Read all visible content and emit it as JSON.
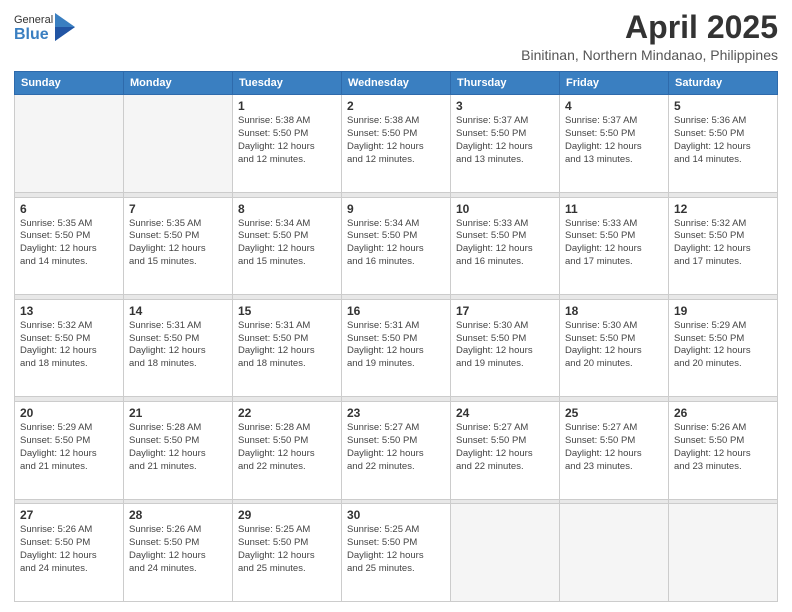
{
  "logo": {
    "general": "General",
    "blue": "Blue"
  },
  "header": {
    "month": "April 2025",
    "location": "Binitinan, Northern Mindanao, Philippines"
  },
  "weekdays": [
    "Sunday",
    "Monday",
    "Tuesday",
    "Wednesday",
    "Thursday",
    "Friday",
    "Saturday"
  ],
  "weeks": [
    [
      {
        "day": "",
        "info": ""
      },
      {
        "day": "",
        "info": ""
      },
      {
        "day": "1",
        "info": "Sunrise: 5:38 AM\nSunset: 5:50 PM\nDaylight: 12 hours\nand 12 minutes."
      },
      {
        "day": "2",
        "info": "Sunrise: 5:38 AM\nSunset: 5:50 PM\nDaylight: 12 hours\nand 12 minutes."
      },
      {
        "day": "3",
        "info": "Sunrise: 5:37 AM\nSunset: 5:50 PM\nDaylight: 12 hours\nand 13 minutes."
      },
      {
        "day": "4",
        "info": "Sunrise: 5:37 AM\nSunset: 5:50 PM\nDaylight: 12 hours\nand 13 minutes."
      },
      {
        "day": "5",
        "info": "Sunrise: 5:36 AM\nSunset: 5:50 PM\nDaylight: 12 hours\nand 14 minutes."
      }
    ],
    [
      {
        "day": "6",
        "info": "Sunrise: 5:35 AM\nSunset: 5:50 PM\nDaylight: 12 hours\nand 14 minutes."
      },
      {
        "day": "7",
        "info": "Sunrise: 5:35 AM\nSunset: 5:50 PM\nDaylight: 12 hours\nand 15 minutes."
      },
      {
        "day": "8",
        "info": "Sunrise: 5:34 AM\nSunset: 5:50 PM\nDaylight: 12 hours\nand 15 minutes."
      },
      {
        "day": "9",
        "info": "Sunrise: 5:34 AM\nSunset: 5:50 PM\nDaylight: 12 hours\nand 16 minutes."
      },
      {
        "day": "10",
        "info": "Sunrise: 5:33 AM\nSunset: 5:50 PM\nDaylight: 12 hours\nand 16 minutes."
      },
      {
        "day": "11",
        "info": "Sunrise: 5:33 AM\nSunset: 5:50 PM\nDaylight: 12 hours\nand 17 minutes."
      },
      {
        "day": "12",
        "info": "Sunrise: 5:32 AM\nSunset: 5:50 PM\nDaylight: 12 hours\nand 17 minutes."
      }
    ],
    [
      {
        "day": "13",
        "info": "Sunrise: 5:32 AM\nSunset: 5:50 PM\nDaylight: 12 hours\nand 18 minutes."
      },
      {
        "day": "14",
        "info": "Sunrise: 5:31 AM\nSunset: 5:50 PM\nDaylight: 12 hours\nand 18 minutes."
      },
      {
        "day": "15",
        "info": "Sunrise: 5:31 AM\nSunset: 5:50 PM\nDaylight: 12 hours\nand 18 minutes."
      },
      {
        "day": "16",
        "info": "Sunrise: 5:31 AM\nSunset: 5:50 PM\nDaylight: 12 hours\nand 19 minutes."
      },
      {
        "day": "17",
        "info": "Sunrise: 5:30 AM\nSunset: 5:50 PM\nDaylight: 12 hours\nand 19 minutes."
      },
      {
        "day": "18",
        "info": "Sunrise: 5:30 AM\nSunset: 5:50 PM\nDaylight: 12 hours\nand 20 minutes."
      },
      {
        "day": "19",
        "info": "Sunrise: 5:29 AM\nSunset: 5:50 PM\nDaylight: 12 hours\nand 20 minutes."
      }
    ],
    [
      {
        "day": "20",
        "info": "Sunrise: 5:29 AM\nSunset: 5:50 PM\nDaylight: 12 hours\nand 21 minutes."
      },
      {
        "day": "21",
        "info": "Sunrise: 5:28 AM\nSunset: 5:50 PM\nDaylight: 12 hours\nand 21 minutes."
      },
      {
        "day": "22",
        "info": "Sunrise: 5:28 AM\nSunset: 5:50 PM\nDaylight: 12 hours\nand 22 minutes."
      },
      {
        "day": "23",
        "info": "Sunrise: 5:27 AM\nSunset: 5:50 PM\nDaylight: 12 hours\nand 22 minutes."
      },
      {
        "day": "24",
        "info": "Sunrise: 5:27 AM\nSunset: 5:50 PM\nDaylight: 12 hours\nand 22 minutes."
      },
      {
        "day": "25",
        "info": "Sunrise: 5:27 AM\nSunset: 5:50 PM\nDaylight: 12 hours\nand 23 minutes."
      },
      {
        "day": "26",
        "info": "Sunrise: 5:26 AM\nSunset: 5:50 PM\nDaylight: 12 hours\nand 23 minutes."
      }
    ],
    [
      {
        "day": "27",
        "info": "Sunrise: 5:26 AM\nSunset: 5:50 PM\nDaylight: 12 hours\nand 24 minutes."
      },
      {
        "day": "28",
        "info": "Sunrise: 5:26 AM\nSunset: 5:50 PM\nDaylight: 12 hours\nand 24 minutes."
      },
      {
        "day": "29",
        "info": "Sunrise: 5:25 AM\nSunset: 5:50 PM\nDaylight: 12 hours\nand 25 minutes."
      },
      {
        "day": "30",
        "info": "Sunrise: 5:25 AM\nSunset: 5:50 PM\nDaylight: 12 hours\nand 25 minutes."
      },
      {
        "day": "",
        "info": ""
      },
      {
        "day": "",
        "info": ""
      },
      {
        "day": "",
        "info": ""
      }
    ]
  ]
}
